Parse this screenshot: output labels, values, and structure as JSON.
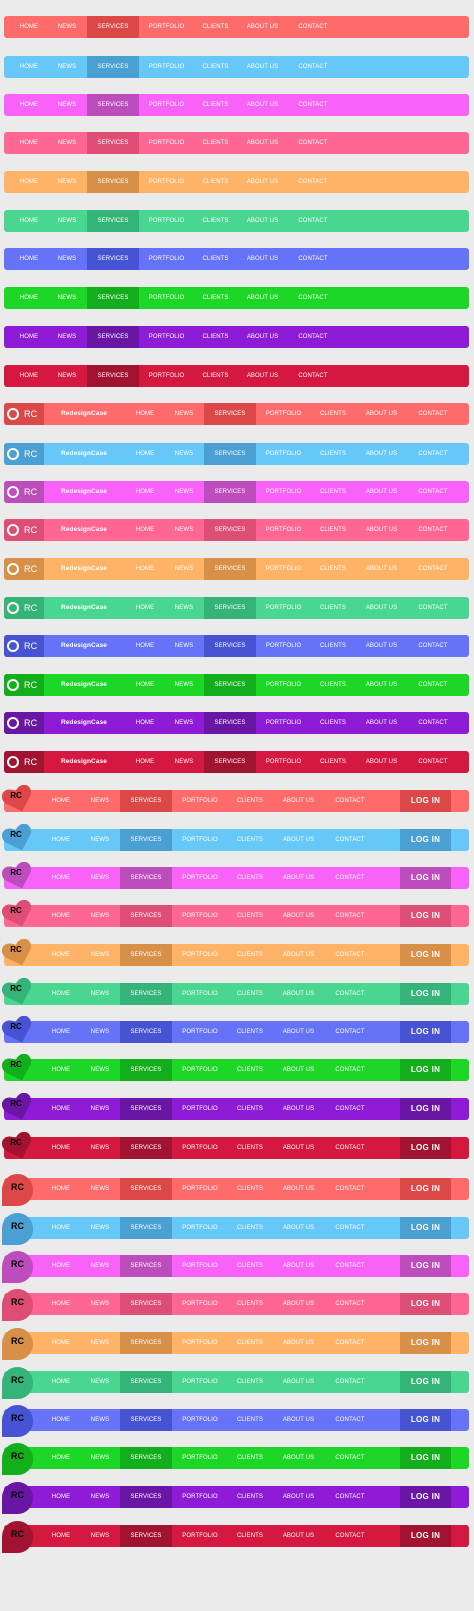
{
  "nav_items": [
    "HOME",
    "NEWS",
    "SERVICES",
    "PORTFOLIO",
    "CLIENTS",
    "ABOUT US",
    "CONTACT"
  ],
  "logo_text": "RC",
  "brand_name": "RedesignCase",
  "login_label": "LOG IN",
  "active_item": "SERVICES",
  "icons": {
    "ring": "circle-ring-icon",
    "heart": "heart-badge-icon",
    "tear": "teardrop-badge-icon"
  },
  "themes": [
    {
      "name": "coral",
      "base": "#ff6b6b",
      "dark": "#dc4848"
    },
    {
      "name": "sky",
      "base": "#66c8f9",
      "dark": "#4a9fd3"
    },
    {
      "name": "magenta",
      "base": "#f962f9",
      "dark": "#bd4cbd"
    },
    {
      "name": "pink",
      "base": "#ff6692",
      "dark": "#dd4d74"
    },
    {
      "name": "orange",
      "base": "#ffb366",
      "dark": "#d89048"
    },
    {
      "name": "mint",
      "base": "#48d691",
      "dark": "#34b478"
    },
    {
      "name": "periwinkle",
      "base": "#6573f9",
      "dark": "#4653d3"
    },
    {
      "name": "green",
      "base": "#1dd726",
      "dark": "#13ae1b"
    },
    {
      "name": "purple",
      "base": "#8e1cd6",
      "dark": "#6a16a4"
    },
    {
      "name": "crimson",
      "base": "#d4183f",
      "dark": "#a21231"
    }
  ],
  "sections": [
    {
      "style": "simple",
      "count": 10
    },
    {
      "style": "brand",
      "count": 10
    },
    {
      "style": "heart-login",
      "count": 10
    },
    {
      "style": "drop-login",
      "count": 10
    }
  ]
}
